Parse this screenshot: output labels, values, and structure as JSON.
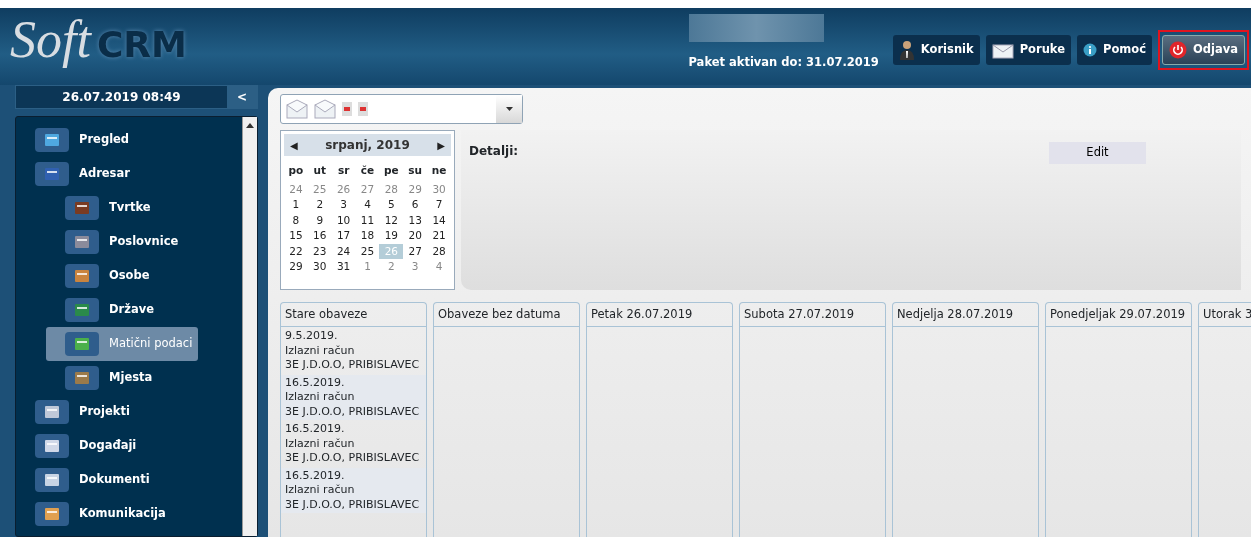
{
  "logo": {
    "script": "Soft",
    "bold": "CRM"
  },
  "package_status": "Paket aktivan do: 31.07.2019",
  "header_buttons": [
    {
      "label": "Korisnik",
      "highlighted": false
    },
    {
      "label": "Poruke",
      "highlighted": false
    },
    {
      "label": "Pomoć",
      "highlighted": false
    },
    {
      "label": "Odjava",
      "highlighted": true
    }
  ],
  "datetime": "26.07.2019 08:49",
  "collapse_button": "<",
  "sidebar": {
    "items": [
      {
        "label": "Pregled",
        "selected": false
      },
      {
        "label": "Adresar",
        "selected": false,
        "children": [
          {
            "label": "Tvrtke",
            "selected": false
          },
          {
            "label": "Poslovnice",
            "selected": false
          },
          {
            "label": "Osobe",
            "selected": false
          },
          {
            "label": "Države",
            "selected": false
          },
          {
            "label": "Matični podaci",
            "selected": true
          },
          {
            "label": "Mjesta",
            "selected": false
          }
        ]
      },
      {
        "label": "Projekti",
        "selected": false
      },
      {
        "label": "Događaji",
        "selected": false
      },
      {
        "label": "Dokumenti",
        "selected": false
      },
      {
        "label": "Komunikacija",
        "selected": false
      }
    ]
  },
  "calendar": {
    "prev": "◀",
    "title": "srpanj, 2019",
    "next": "▶",
    "weekdays": [
      "po",
      "ut",
      "sr",
      "če",
      "pe",
      "su",
      "ne"
    ],
    "weeks": [
      [
        {
          "d": "24",
          "outside": true,
          "selected": false
        },
        {
          "d": "25",
          "outside": true,
          "selected": false
        },
        {
          "d": "26",
          "outside": true,
          "selected": false
        },
        {
          "d": "27",
          "outside": true,
          "selected": false
        },
        {
          "d": "28",
          "outside": true,
          "selected": false
        },
        {
          "d": "29",
          "outside": true,
          "selected": false
        },
        {
          "d": "30",
          "outside": true,
          "selected": false
        }
      ],
      [
        {
          "d": "1",
          "outside": false,
          "selected": false
        },
        {
          "d": "2",
          "outside": false,
          "selected": false
        },
        {
          "d": "3",
          "outside": false,
          "selected": false
        },
        {
          "d": "4",
          "outside": false,
          "selected": false
        },
        {
          "d": "5",
          "outside": false,
          "selected": false
        },
        {
          "d": "6",
          "outside": false,
          "selected": false
        },
        {
          "d": "7",
          "outside": false,
          "selected": false
        }
      ],
      [
        {
          "d": "8",
          "outside": false,
          "selected": false
        },
        {
          "d": "9",
          "outside": false,
          "selected": false
        },
        {
          "d": "10",
          "outside": false,
          "selected": false
        },
        {
          "d": "11",
          "outside": false,
          "selected": false
        },
        {
          "d": "12",
          "outside": false,
          "selected": false
        },
        {
          "d": "13",
          "outside": false,
          "selected": false
        },
        {
          "d": "14",
          "outside": false,
          "selected": false
        }
      ],
      [
        {
          "d": "15",
          "outside": false,
          "selected": false
        },
        {
          "d": "16",
          "outside": false,
          "selected": false
        },
        {
          "d": "17",
          "outside": false,
          "selected": false
        },
        {
          "d": "18",
          "outside": false,
          "selected": false
        },
        {
          "d": "19",
          "outside": false,
          "selected": false
        },
        {
          "d": "20",
          "outside": false,
          "selected": false
        },
        {
          "d": "21",
          "outside": false,
          "selected": false
        }
      ],
      [
        {
          "d": "22",
          "outside": false,
          "selected": false
        },
        {
          "d": "23",
          "outside": false,
          "selected": false
        },
        {
          "d": "24",
          "outside": false,
          "selected": false
        },
        {
          "d": "25",
          "outside": false,
          "selected": false
        },
        {
          "d": "26",
          "outside": false,
          "selected": true
        },
        {
          "d": "27",
          "outside": false,
          "selected": false
        },
        {
          "d": "28",
          "outside": false,
          "selected": false
        }
      ],
      [
        {
          "d": "29",
          "outside": false,
          "selected": false
        },
        {
          "d": "30",
          "outside": false,
          "selected": false
        },
        {
          "d": "31",
          "outside": false,
          "selected": false
        },
        {
          "d": "1",
          "outside": true,
          "selected": false
        },
        {
          "d": "2",
          "outside": true,
          "selected": false
        },
        {
          "d": "3",
          "outside": true,
          "selected": false
        },
        {
          "d": "4",
          "outside": true,
          "selected": false
        }
      ]
    ]
  },
  "details": {
    "label": "Detalji:",
    "button": "Edit"
  },
  "columns": [
    {
      "title": "Stare obaveze",
      "tasks": [
        {
          "date": "9.5.2019.",
          "type": "Izlazni račun",
          "client": "3E J.D.O.O, PRIBISLAVEC"
        },
        {
          "date": "16.5.2019.",
          "type": "Izlazni račun",
          "client": "3E J.D.O.O, PRIBISLAVEC"
        },
        {
          "date": "16.5.2019.",
          "type": "Izlazni račun",
          "client": "3E J.D.O.O, PRIBISLAVEC"
        },
        {
          "date": "16.5.2019.",
          "type": "Izlazni račun",
          "client": "3E J.D.O.O, PRIBISLAVEC"
        }
      ]
    },
    {
      "title": "Obaveze bez datuma"
    },
    {
      "title": "Petak 26.07.2019"
    },
    {
      "title": "Subota 27.07.2019"
    },
    {
      "title": "Nedjelja 28.07.2019"
    },
    {
      "title": "Ponedjeljak 29.07.2019"
    },
    {
      "title": "Utorak 3"
    }
  ]
}
